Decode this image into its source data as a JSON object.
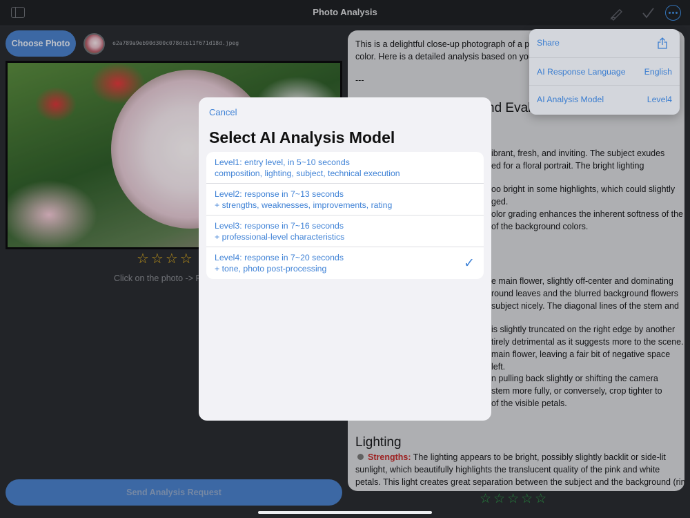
{
  "header": {
    "title": "Photo Analysis"
  },
  "left": {
    "choose_photo": "Choose Photo",
    "filename": "e2a789a9eb90d300c078dcb11f671d18d.jpeg",
    "stars": "☆☆☆☆",
    "hint": "Click on the photo -> F",
    "send_button": "Send Analysis Request"
  },
  "analysis": {
    "lines": [
      "This is a delightful close-up photograph of a pe",
      "color. Here is a detailed analysis based on your",
      "---",
      "ibrant, fresh, and inviting. The subject exudes",
      "ed for a floral portrait. The bright lighting",
      "oo bright in some highlights, which could slightly",
      "ged.",
      "olor grading enhances the inherent softness of the",
      "of the background colors.",
      "e main flower, slightly off-center and dominating",
      "round leaves and the blurred background flowers",
      "subject nicely. The diagonal lines of the stem and",
      "is slightly truncated on the right edge by another",
      "tirely detrimental as it suggests more to the scene.",
      "main flower, leaving a fair bit of negative space",
      "left.",
      "n pulling back slightly or shifting the camera",
      "stem more fully, or conversely, crop tighter to",
      "of the visible petals."
    ],
    "heading_partial": "nd Eval",
    "lighting_heading": "Lighting",
    "lighting_strength_label": "Strengths:",
    "lighting_line1": "The lighting appears to be bright, possibly slightly backlit or side-lit",
    "lighting_line2": "sunlight, which beautifully highlights the translucent quality of the pink and white",
    "lighting_line3": "petals. This light creates great separation between the subject and the background (rim",
    "stars": "☆☆☆☆☆"
  },
  "modal": {
    "cancel": "Cancel",
    "title": "Select AI Analysis Model",
    "options": [
      {
        "line1": "Level1: entry level, in 5~10 seconds",
        "line2": "composition, lighting, subject, technical execution",
        "selected": false
      },
      {
        "line1": "Level2: response in 7~13 seconds",
        "line2": "+ strengths, weaknesses, improvements, rating",
        "selected": false
      },
      {
        "line1": "Level3: response in 7~16 seconds",
        "line2": "+ professional-level characteristics",
        "selected": false
      },
      {
        "line1": "Level4: response in 7~20 seconds",
        "line2": "+ tone, photo post-processing",
        "selected": true
      }
    ],
    "check_mark": "✓"
  },
  "menu": {
    "share": "Share",
    "language_label": "AI Response Language",
    "language_value": "English",
    "model_label": "AI Analysis Model",
    "model_value": "Level4"
  },
  "colors": {
    "accent": "#3f82d6",
    "button": "#4a7fc8",
    "star_yellow": "#e6b320",
    "star_green": "#2e9e4a",
    "strength_red": "#c02a2a"
  }
}
